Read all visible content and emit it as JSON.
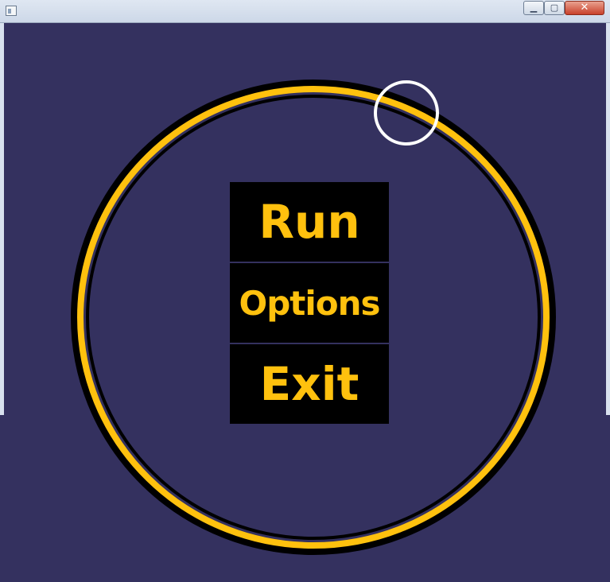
{
  "window": {
    "title": "",
    "controls": {
      "minimize": "▁",
      "maximize": "▢",
      "close": "✕"
    }
  },
  "menu": {
    "items": [
      {
        "label": "Run"
      },
      {
        "label": "Options"
      },
      {
        "label": "Exit"
      }
    ]
  },
  "colors": {
    "background": "#34315f",
    "accent": "#ffc10e",
    "menu_background": "#000000",
    "cursor_ring": "#ffffff"
  }
}
